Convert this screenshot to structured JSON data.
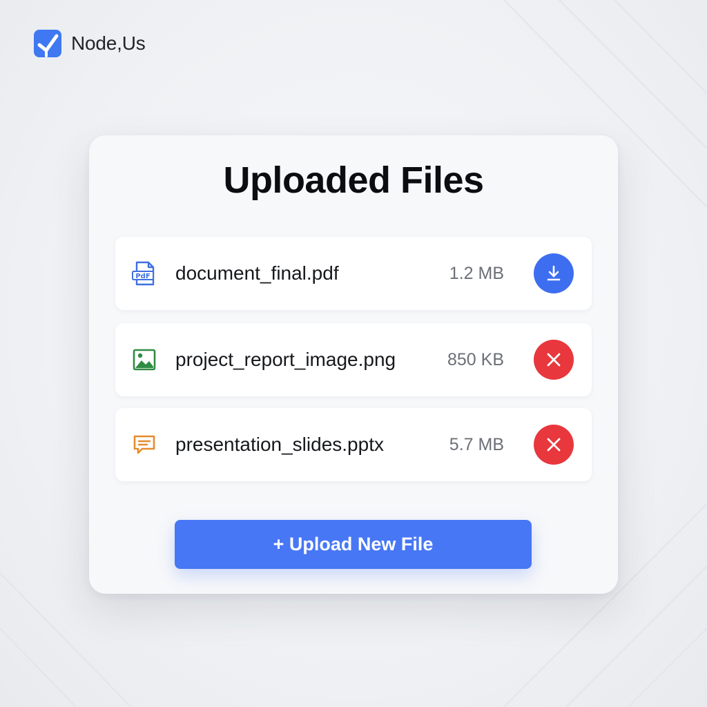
{
  "brand": {
    "name": "Node,Us",
    "logo_icon": "brand-logo-icon",
    "logo_color": "#3f78f0"
  },
  "card": {
    "title": "Uploaded Files"
  },
  "files": [
    {
      "name": "document_final.pdf",
      "size": "1.2 MB",
      "icon": "pdf-file-icon",
      "icon_text": "PdF",
      "icon_color": "#3f6fe0",
      "action": "download",
      "action_icon": "download-icon",
      "action_color": "#3e6ef0"
    },
    {
      "name": "project_report_image.png",
      "size": "850 KB",
      "icon": "image-file-icon",
      "icon_color": "#2e8c43",
      "action": "remove",
      "action_icon": "close-icon",
      "action_color": "#e8373d"
    },
    {
      "name": "presentation_slides.pptx",
      "size": "5.7 MB",
      "icon": "presentation-file-icon",
      "icon_color": "#e68a2e",
      "action": "remove",
      "action_icon": "close-icon",
      "action_color": "#e8373d"
    }
  ],
  "upload_button": {
    "label": "+ Upload New File",
    "color": "#4777f5"
  }
}
